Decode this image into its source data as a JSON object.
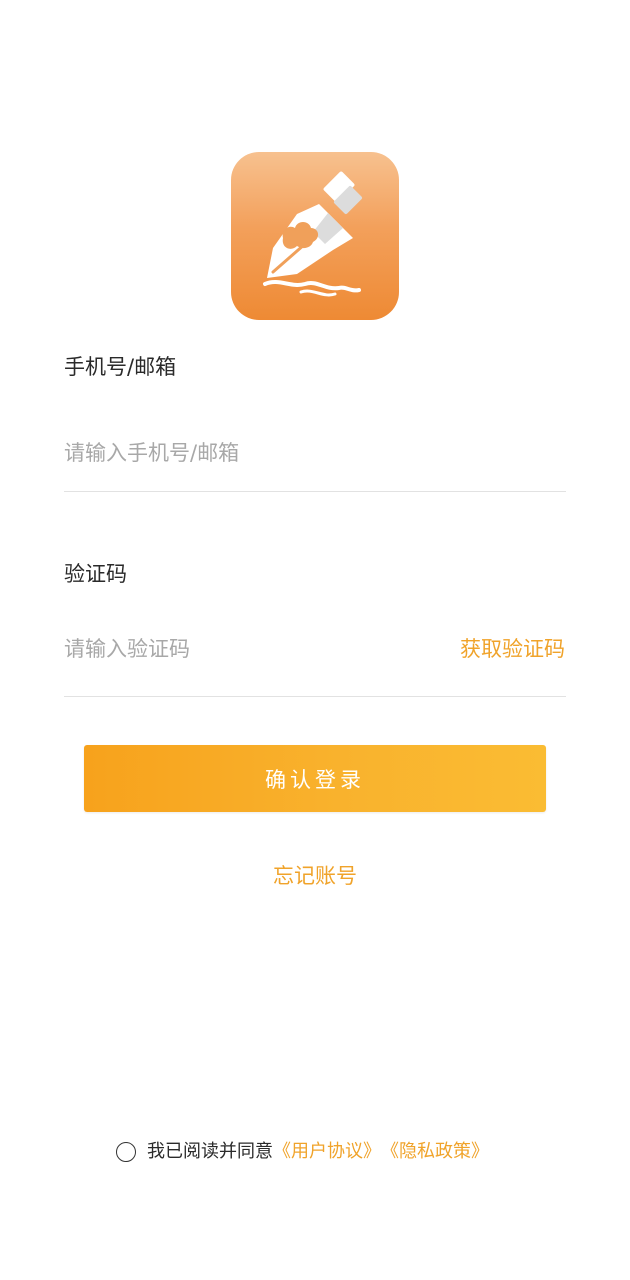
{
  "logo": {
    "icon": "fountain-pen-nib-icon",
    "background_top": "#f7c18f",
    "background_bottom": "#ee8a34"
  },
  "form": {
    "account_label": "手机号/邮箱",
    "account_placeholder": "请输入手机号/邮箱",
    "account_value": "",
    "code_label": "验证码",
    "code_placeholder": "请输入验证码",
    "code_value": "",
    "get_code_label": "获取验证码",
    "login_label": "确认登录",
    "forgot_label": "忘记账号"
  },
  "agreement": {
    "text": "我已阅读并同意",
    "user_agreement": "《用户协议》",
    "privacy_policy": "《隐私政策》",
    "checked": false
  },
  "colors": {
    "accent": "#f0a32a",
    "button_start": "#f7a21c",
    "button_end": "#fabc33",
    "divider": "#e2e2e2"
  }
}
